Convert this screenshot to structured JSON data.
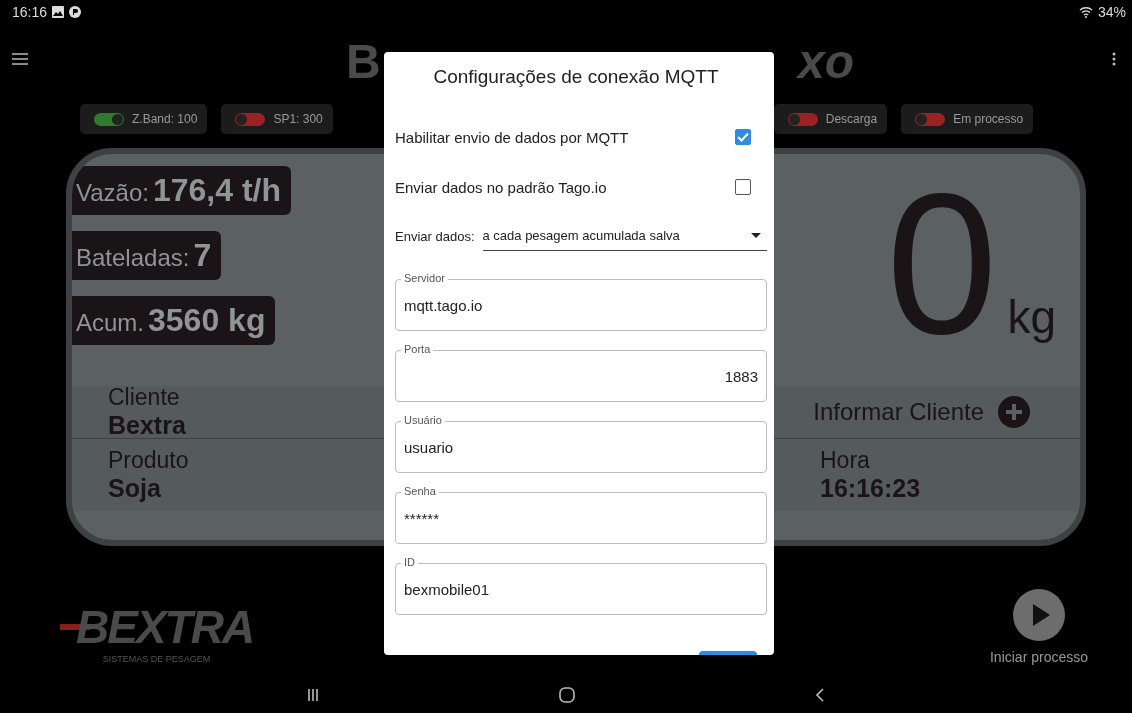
{
  "status_bar": {
    "time": "16:16",
    "battery": "34%"
  },
  "app_title_fragments": {
    "left": "B",
    "right": "xo"
  },
  "chips": [
    {
      "label": "Z.Band: 100",
      "on": true
    },
    {
      "label": "SP1: 300",
      "on": false
    },
    {
      "label": "Descarga",
      "on": false
    },
    {
      "label": "Em processo",
      "on": false
    }
  ],
  "stats": [
    {
      "label": "Vazão:",
      "value": "176,4 t/h"
    },
    {
      "label": "Bateladas:",
      "value": "7"
    },
    {
      "label": "Acum.",
      "value": "3560 kg"
    }
  ],
  "weight": {
    "value": "0",
    "unit": "kg"
  },
  "info_rows": [
    {
      "label": "Cliente",
      "value": "Bextra",
      "action": "Informar Cliente"
    },
    {
      "label": "Produto",
      "value": "Soja",
      "right_label": "Hora",
      "right_value": "16:16:23"
    }
  ],
  "logo": {
    "text": "BEXTRA",
    "tagline": "SISTEMAS DE PESAGEM"
  },
  "start_button": {
    "label": "Iniciar processo"
  },
  "dialog": {
    "title": "Configurações de conexão MQTT",
    "checks": [
      {
        "label": "Habilitar envio de dados por MQTT",
        "checked": true
      },
      {
        "label": "Enviar dados no padrão Tago.io",
        "checked": false
      }
    ],
    "select": {
      "label": "Enviar dados:",
      "value": "a cada pesagem acumulada salva"
    },
    "fields": [
      {
        "label": "Servidor",
        "value": "mqtt.tago.io",
        "kind": "text"
      },
      {
        "label": "Porta",
        "value": "1883",
        "kind": "number"
      },
      {
        "label": "Usuário",
        "value": "usuario",
        "kind": "text"
      },
      {
        "label": "Senha",
        "value": "******",
        "kind": "password"
      },
      {
        "label": "ID",
        "value": "bexmobile01",
        "kind": "text"
      }
    ]
  }
}
